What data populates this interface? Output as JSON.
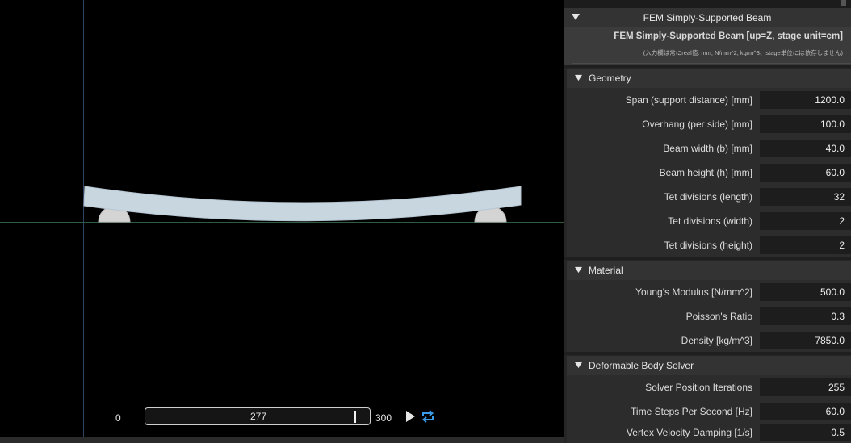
{
  "viewport": {
    "timeline": {
      "start": "0",
      "current": "277",
      "end": "300"
    },
    "icons": {
      "play": "play-icon",
      "loop": "loop-icon"
    },
    "colors": {
      "background": "#000000",
      "beam": "#c8d6e0",
      "support": "#cfcfcf",
      "loop_accent": "#3a9be8"
    }
  },
  "panel": {
    "title": "FEM Simply-Supported Beam",
    "intro": {
      "title": "FEM Simply-Supported Beam  [up=Z, stage unit=cm]",
      "note": "(入力欄は常にreal値: mm, N/mm^2, kg/m^3、stage単位には依存しません)"
    },
    "sections": [
      {
        "label": "Geometry",
        "rows": [
          {
            "label": "Span (support distance) [mm]",
            "value": "1200.0"
          },
          {
            "label": "Overhang (per side) [mm]",
            "value": "100.0"
          },
          {
            "label": "Beam width (b) [mm]",
            "value": "40.0"
          },
          {
            "label": "Beam height (h) [mm]",
            "value": "60.0"
          },
          {
            "label": "Tet divisions (length)",
            "value": "32"
          },
          {
            "label": "Tet divisions (width)",
            "value": "2"
          },
          {
            "label": "Tet divisions (height)",
            "value": "2"
          }
        ]
      },
      {
        "label": "Material",
        "rows": [
          {
            "label": "Young's Modulus [N/mm^2]",
            "value": "500.0"
          },
          {
            "label": "Poisson's Ratio",
            "value": "0.3"
          },
          {
            "label": "Density [kg/m^3]",
            "value": "7850.0"
          }
        ]
      },
      {
        "label": "Deformable Body Solver",
        "rows": [
          {
            "label": "Solver Position Iterations",
            "value": "255"
          },
          {
            "label": "Time Steps Per Second [Hz]",
            "value": "60.0"
          },
          {
            "label": "Vertex Velocity Damping [1/s]",
            "value": "0.5"
          }
        ]
      }
    ]
  }
}
